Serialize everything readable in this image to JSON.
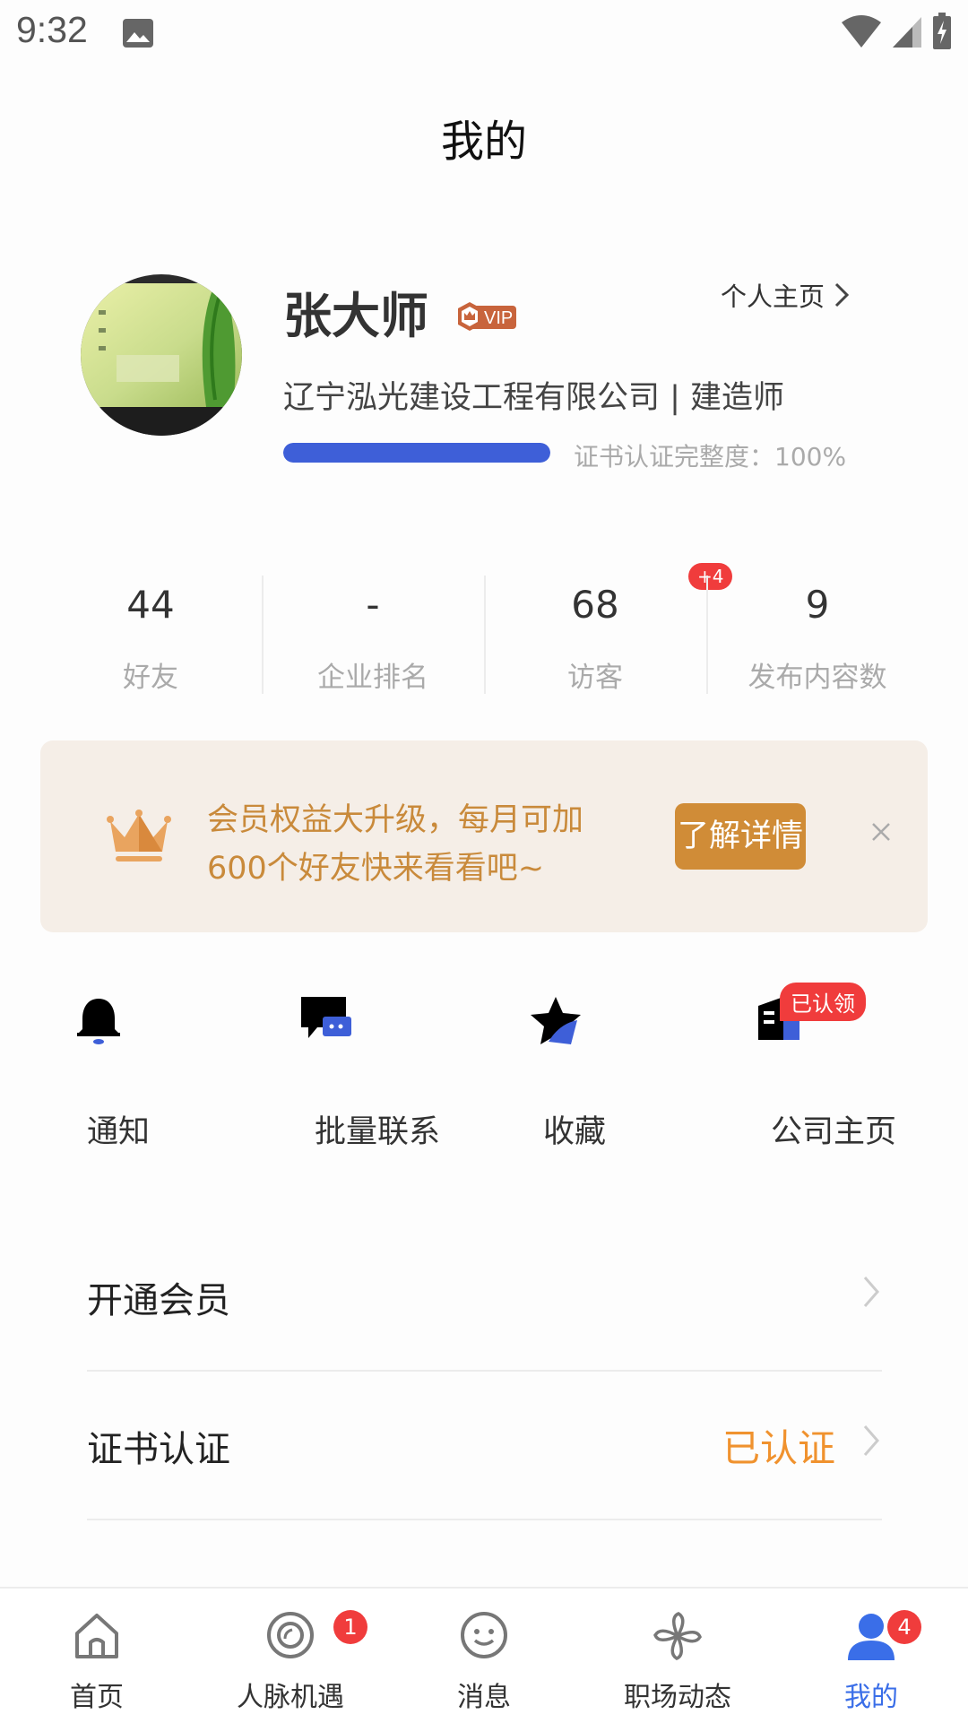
{
  "status_bar": {
    "time": "9:32"
  },
  "header": {
    "title": "我的"
  },
  "profile": {
    "name": "张大师",
    "vip_label": "VIP",
    "homepage_link": "个人主页",
    "company": "辽宁泓光建设工程有限公司 | 建造师",
    "cert_label": "证书认证完整度：",
    "cert_value": "100%",
    "cert_progress_percent": 100
  },
  "stats": [
    {
      "value": "44",
      "label": "好友"
    },
    {
      "value": "-",
      "label": "企业排名"
    },
    {
      "value": "68",
      "label": "访客",
      "badge": "+4"
    },
    {
      "value": "9",
      "label": "发布内容数"
    }
  ],
  "banner": {
    "line1": "会员权益大升级，每月可加",
    "line2": "600个好友快来看看吧~",
    "button": "了解详情"
  },
  "quick_actions": [
    {
      "label": "通知",
      "icon": "bell-icon"
    },
    {
      "label": "批量联系",
      "icon": "chat-icon"
    },
    {
      "label": "收藏",
      "icon": "star-icon"
    },
    {
      "label": "公司主页",
      "icon": "building-icon",
      "badge": "已认领"
    }
  ],
  "menu": [
    {
      "label": "开通会员",
      "value": ""
    },
    {
      "label": "证书认证",
      "value": "已认证"
    }
  ],
  "tabbar": {
    "items": [
      {
        "label": "首页",
        "icon": "home-icon"
      },
      {
        "label": "人脉机遇",
        "icon": "target-icon",
        "badge": "1"
      },
      {
        "label": "消息",
        "icon": "smile-icon"
      },
      {
        "label": "职场动态",
        "icon": "pinwheel-icon"
      },
      {
        "label": "我的",
        "icon": "person-icon",
        "badge": "4",
        "active": true
      }
    ]
  },
  "colors": {
    "accent": "#3a6ee8",
    "progress": "#3e5fd8",
    "banner_bg": "#f5eee7",
    "banner_button": "#d08c37",
    "badge": "#f03c3c",
    "verified": "#f0922e"
  }
}
